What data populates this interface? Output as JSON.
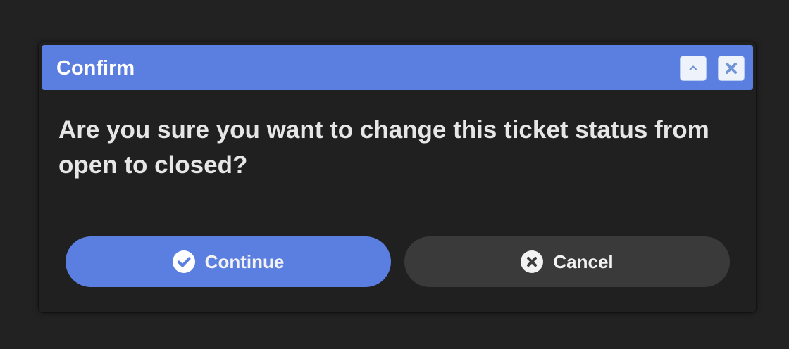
{
  "dialog": {
    "title": "Confirm",
    "message": "Are you sure you want to change this ticket status from open to closed?",
    "buttons": {
      "continue_label": "Continue",
      "cancel_label": "Cancel"
    },
    "titlebar_buttons": {
      "collapse_icon": "chevron-up-icon",
      "close_icon": "close-icon"
    }
  },
  "colors": {
    "accent": "#5b7fe0",
    "background": "#222222",
    "dialog_body": "#202020",
    "cancel_button": "#3a3a3a",
    "text": "#e6e6e6"
  }
}
